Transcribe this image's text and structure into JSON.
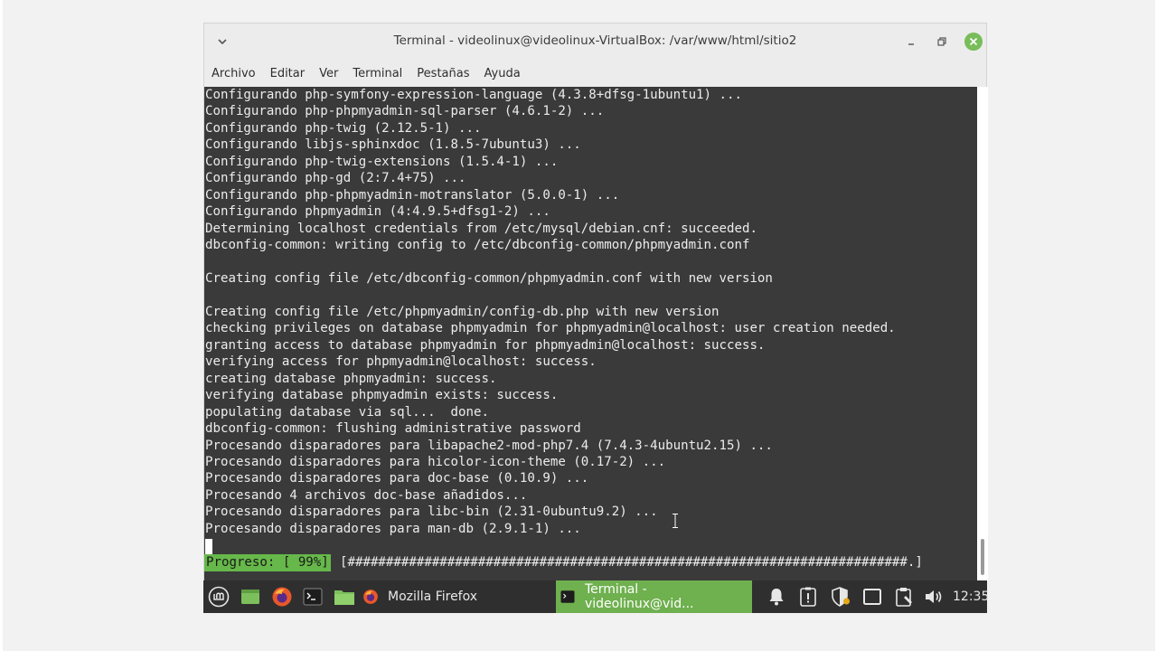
{
  "window": {
    "title": "Terminal - videolinux@videolinux-VirtualBox: /var/www/html/sitio2",
    "menu": [
      "Archivo",
      "Editar",
      "Ver",
      "Terminal",
      "Pestañas",
      "Ayuda"
    ]
  },
  "terminal": {
    "lines": [
      "Configurando php-symfony-expression-language (4.3.8+dfsg-1ubuntu1) ...",
      "Configurando php-phpmyadmin-sql-parser (4.6.1-2) ...",
      "Configurando php-twig (2.12.5-1) ...",
      "Configurando libjs-sphinxdoc (1.8.5-7ubuntu3) ...",
      "Configurando php-twig-extensions (1.5.4-1) ...",
      "Configurando php-gd (2:7.4+75) ...",
      "Configurando php-phpmyadmin-motranslator (5.0.0-1) ...",
      "Configurando phpmyadmin (4:4.9.5+dfsg1-2) ...",
      "Determining localhost credentials from /etc/mysql/debian.cnf: succeeded.",
      "dbconfig-common: writing config to /etc/dbconfig-common/phpmyadmin.conf",
      "",
      "Creating config file /etc/dbconfig-common/phpmyadmin.conf with new version",
      "",
      "Creating config file /etc/phpmyadmin/config-db.php with new version",
      "checking privileges on database phpmyadmin for phpmyadmin@localhost: user creation needed.",
      "granting access to database phpmyadmin for phpmyadmin@localhost: success.",
      "verifying access for phpmyadmin@localhost: success.",
      "creating database phpmyadmin: success.",
      "verifying database phpmyadmin exists: success.",
      "populating database via sql...  done.",
      "dbconfig-common: flushing administrative password",
      "Procesando disparadores para libapache2-mod-php7.4 (7.4.3-4ubuntu2.15) ...",
      "Procesando disparadores para hicolor-icon-theme (0.17-2) ...",
      "Procesando disparadores para doc-base (0.10.9) ...",
      "Procesando 4 archivos doc-base añadidos...",
      "Procesando disparadores para libc-bin (2.31-0ubuntu9.2) ...",
      "Procesando disparadores para man-db (2.9.1-1) ..."
    ],
    "progress_label": "Progreso: [ 99%]",
    "progress_bar": "[#########################################################################.]",
    "progress_percent": 99
  },
  "panel": {
    "tasks": [
      {
        "label": "Mozilla Firefox",
        "active": false
      },
      {
        "label": "Terminal - videolinux@vid...",
        "active": true
      }
    ],
    "clock": "12:35"
  },
  "colors": {
    "terminal_bg": "#3a3a3a",
    "accent_green": "#6fb04f",
    "panel_bg": "#2f2f2f"
  }
}
